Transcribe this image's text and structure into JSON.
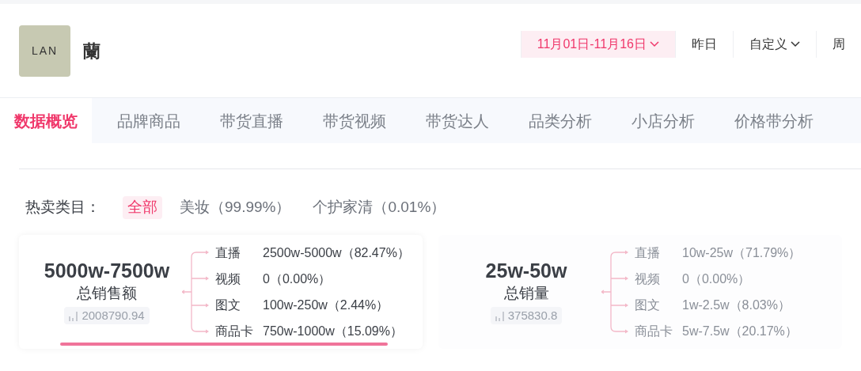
{
  "brand": {
    "logo": "LAN",
    "name": "蘭"
  },
  "date_filters": [
    {
      "label": "11月01日-11月16日",
      "selected": true,
      "dropdown": true
    },
    {
      "label": "昨日",
      "selected": false,
      "dropdown": false
    },
    {
      "label": "自定义",
      "selected": false,
      "dropdown": true
    },
    {
      "label": "周",
      "selected": false,
      "dropdown": false
    }
  ],
  "tabs": [
    {
      "label": "数据概览",
      "selected": true
    },
    {
      "label": "品牌商品",
      "selected": false
    },
    {
      "label": "带货直播",
      "selected": false
    },
    {
      "label": "带货视频",
      "selected": false
    },
    {
      "label": "带货达人",
      "selected": false
    },
    {
      "label": "品类分析",
      "selected": false
    },
    {
      "label": "小店分析",
      "selected": false
    },
    {
      "label": "价格带分析",
      "selected": false
    }
  ],
  "categories": {
    "label": "热卖类目：",
    "items": [
      {
        "label": "全部",
        "selected": true
      },
      {
        "label": "美妆（99.99%）",
        "selected": false
      },
      {
        "label": "个护家清（0.01%）",
        "selected": false
      }
    ]
  },
  "metrics": [
    {
      "value": "5000w-7500w",
      "label": "总销售额",
      "exact": "2008790.94",
      "selected": true,
      "breakdown": [
        {
          "channel": "直播",
          "value": "2500w-5000w（82.47%）"
        },
        {
          "channel": "视频",
          "value": "0（0.00%）"
        },
        {
          "channel": "图文",
          "value": "100w-250w（2.44%）"
        },
        {
          "channel": "商品卡",
          "value": "750w-1000w（15.09%）"
        }
      ]
    },
    {
      "value": "25w-50w",
      "label": "总销量",
      "exact": "375830.8",
      "selected": false,
      "breakdown": [
        {
          "channel": "直播",
          "value": "10w-25w（71.79%）"
        },
        {
          "channel": "视频",
          "value": "0（0.00%）"
        },
        {
          "channel": "图文",
          "value": "1w-2.5w（8.03%）"
        },
        {
          "channel": "商品卡",
          "value": "5w-7.5w（20.17%）"
        }
      ]
    }
  ]
}
